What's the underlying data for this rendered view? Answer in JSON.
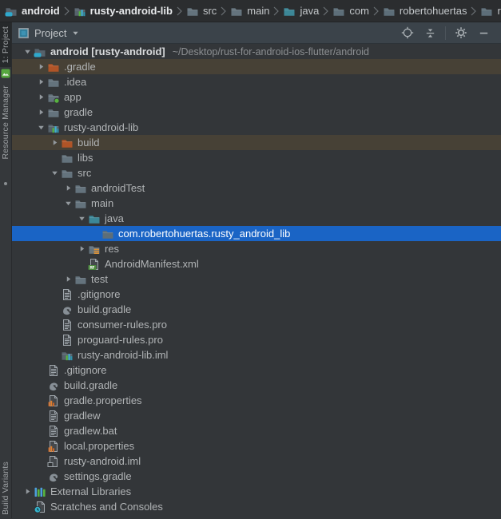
{
  "colors": {
    "selection_blue": "#1a64c5",
    "excluded_row_bg": "#474136",
    "breadcrumb_bg": "#2b2d2f",
    "panel_header_bg": "#3b434a",
    "tree_bg": "#333639",
    "excluded_folder_orange": "#b05427",
    "android_green": "#57b33f",
    "java_folder_teal": "#3c8797"
  },
  "breadcrumbs": {
    "items": [
      {
        "label": "android",
        "icon": "android-project",
        "bold": true
      },
      {
        "label": "rusty-android-lib",
        "icon": "module",
        "bold": true
      },
      {
        "label": "src",
        "icon": "folder",
        "bold": false
      },
      {
        "label": "main",
        "icon": "folder",
        "bold": false
      },
      {
        "label": "java",
        "icon": "java-folder",
        "bold": false
      },
      {
        "label": "com",
        "icon": "package",
        "bold": false
      },
      {
        "label": "robertohuertas",
        "icon": "package",
        "bold": false
      },
      {
        "label": "rusty_andr",
        "icon": "package",
        "bold": false
      }
    ]
  },
  "stripe": {
    "project_tab": "1: Project",
    "resource_manager": "Resource Manager",
    "build_variants": "Build Variants"
  },
  "panel_header": {
    "title": "Project"
  },
  "tree": {
    "rows": [
      {
        "label": "android [rusty-android]",
        "annotation": "~/Desktop/rust-for-android-ios-flutter/android",
        "level": 0,
        "arrow": "expanded",
        "icon": "android-project",
        "state": "",
        "bold": true
      },
      {
        "label": ".gradle",
        "level": 1,
        "arrow": "collapsed",
        "icon": "folder-excluded",
        "state": "excluded"
      },
      {
        "label": ".idea",
        "level": 1,
        "arrow": "collapsed",
        "icon": "folder",
        "state": ""
      },
      {
        "label": "app",
        "level": 1,
        "arrow": "collapsed",
        "icon": "app-module",
        "state": ""
      },
      {
        "label": "gradle",
        "level": 1,
        "arrow": "collapsed",
        "icon": "folder",
        "state": ""
      },
      {
        "label": "rusty-android-lib",
        "level": 1,
        "arrow": "expanded",
        "icon": "module",
        "state": ""
      },
      {
        "label": "build",
        "level": 2,
        "arrow": "collapsed",
        "icon": "folder-excluded",
        "state": "excluded"
      },
      {
        "label": "libs",
        "level": 2,
        "arrow": "",
        "icon": "folder",
        "state": ""
      },
      {
        "label": "src",
        "level": 2,
        "arrow": "expanded",
        "icon": "folder",
        "state": ""
      },
      {
        "label": "androidTest",
        "level": 3,
        "arrow": "collapsed",
        "icon": "folder",
        "state": ""
      },
      {
        "label": "main",
        "level": 3,
        "arrow": "expanded",
        "icon": "folder",
        "state": ""
      },
      {
        "label": "java",
        "level": 4,
        "arrow": "expanded",
        "icon": "java-folder",
        "state": ""
      },
      {
        "label": "com.robertohuertas.rusty_android_lib",
        "level": 5,
        "arrow": "",
        "icon": "package",
        "state": "selected"
      },
      {
        "label": "res",
        "level": 4,
        "arrow": "collapsed",
        "icon": "res-folder",
        "state": ""
      },
      {
        "label": "AndroidManifest.xml",
        "level": 4,
        "arrow": "",
        "icon": "manifest",
        "state": ""
      },
      {
        "label": "test",
        "level": 3,
        "arrow": "collapsed",
        "icon": "folder",
        "state": ""
      },
      {
        "label": ".gitignore",
        "level": 2,
        "arrow": "",
        "icon": "file",
        "state": ""
      },
      {
        "label": "build.gradle",
        "level": 2,
        "arrow": "",
        "icon": "gradle",
        "state": ""
      },
      {
        "label": "consumer-rules.pro",
        "level": 2,
        "arrow": "",
        "icon": "file",
        "state": ""
      },
      {
        "label": "proguard-rules.pro",
        "level": 2,
        "arrow": "",
        "icon": "file",
        "state": ""
      },
      {
        "label": "rusty-android-lib.iml",
        "level": 2,
        "arrow": "",
        "icon": "module",
        "state": ""
      },
      {
        "label": ".gitignore",
        "level": 1,
        "arrow": "",
        "icon": "file",
        "state": ""
      },
      {
        "label": "build.gradle",
        "level": 1,
        "arrow": "",
        "icon": "gradle",
        "state": ""
      },
      {
        "label": "gradle.properties",
        "level": 1,
        "arrow": "",
        "icon": "properties",
        "state": ""
      },
      {
        "label": "gradlew",
        "level": 1,
        "arrow": "",
        "icon": "file",
        "state": ""
      },
      {
        "label": "gradlew.bat",
        "level": 1,
        "arrow": "",
        "icon": "file",
        "state": ""
      },
      {
        "label": "local.properties",
        "level": 1,
        "arrow": "",
        "icon": "properties",
        "state": ""
      },
      {
        "label": "rusty-android.iml",
        "level": 1,
        "arrow": "",
        "icon": "iml",
        "state": ""
      },
      {
        "label": "settings.gradle",
        "level": 1,
        "arrow": "",
        "icon": "gradle",
        "state": ""
      },
      {
        "label": "External Libraries",
        "level": 0,
        "arrow": "collapsed",
        "icon": "libraries",
        "state": ""
      },
      {
        "label": "Scratches and Consoles",
        "level": 0,
        "arrow": "",
        "icon": "scratches",
        "state": ""
      }
    ]
  }
}
